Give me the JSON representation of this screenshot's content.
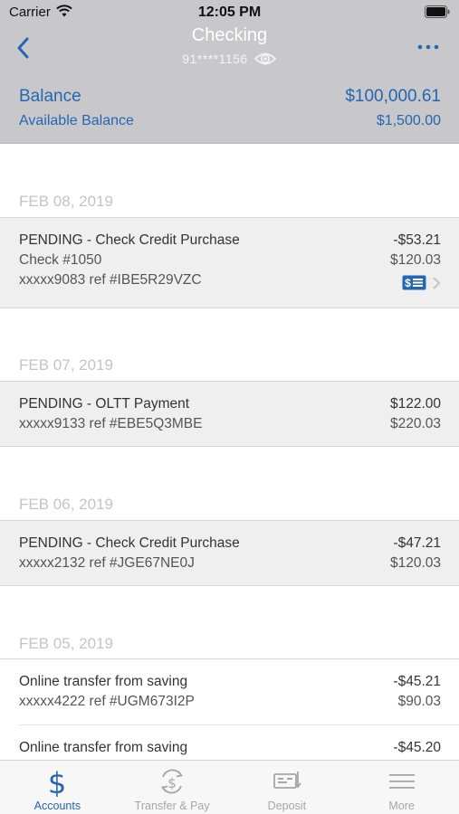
{
  "status_bar": {
    "carrier": "Carrier",
    "time": "12:05 PM"
  },
  "header": {
    "title": "Checking",
    "account_number": "91****1156",
    "balance_label": "Balance",
    "balance_value": "$100,000.61",
    "available_label": "Available Balance",
    "available_value": "$1,500.00"
  },
  "groups": [
    {
      "date": "FEB 08, 2019",
      "transactions": [
        {
          "title": "PENDING - Check Credit Purchase",
          "amount": "-$53.21",
          "line2": "Check #1050",
          "balance": "$120.03",
          "line3": "xxxxx9083 ref #IBE5R29VZC",
          "has_check_image": true
        }
      ]
    },
    {
      "date": "FEB 07, 2019",
      "transactions": [
        {
          "title": "PENDING - OLTT Payment",
          "amount": "$122.00",
          "line2": "xxxxx9133 ref #EBE5Q3MBE",
          "balance": "$220.03"
        }
      ]
    },
    {
      "date": "FEB 06, 2019",
      "transactions": [
        {
          "title": "PENDING - Check Credit Purchase",
          "amount": "-$47.21",
          "line2": "xxxxx2132 ref #JGE67NE0J",
          "balance": "$120.03"
        }
      ]
    },
    {
      "date": "FEB 05, 2019",
      "transactions": [
        {
          "title": "Online transfer from saving",
          "amount": "-$45.21",
          "line2": "xxxxx4222 ref #UGM673I2P",
          "balance": "$90.03"
        },
        {
          "title": "Online transfer from saving",
          "amount": "-$45.20"
        }
      ]
    }
  ],
  "tabs": [
    {
      "label": "Accounts",
      "icon": "dollar-icon",
      "active": true
    },
    {
      "label": "Transfer & Pay",
      "icon": "transfer-icon",
      "active": false
    },
    {
      "label": "Deposit",
      "icon": "deposit-check-icon",
      "active": false
    },
    {
      "label": "More",
      "icon": "menu-icon",
      "active": false
    }
  ],
  "colors": {
    "accent": "#2566b2",
    "header_bg": "#c8c8ca",
    "pending_bg": "#efeff0",
    "date_text": "#c4c4c6"
  }
}
